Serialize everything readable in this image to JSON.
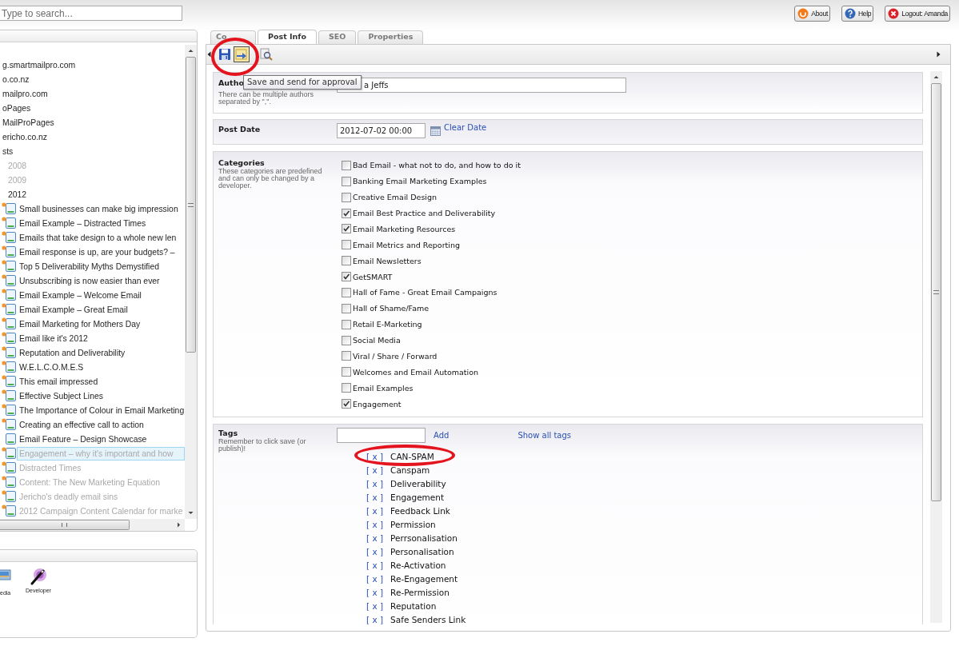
{
  "search": {
    "placeholder": "Type to search..."
  },
  "header_buttons": [
    {
      "kind": "about",
      "label": "About"
    },
    {
      "kind": "help",
      "label": "Help"
    },
    {
      "kind": "logout",
      "label": "Logout: Amanda"
    }
  ],
  "tree": {
    "items": [
      {
        "label": "g.smartmailpro.com",
        "published": true,
        "selected": false
      },
      {
        "label": "o.co.nz",
        "published": true,
        "selected": false
      },
      {
        "label": "mailpro.com",
        "published": true,
        "selected": false
      },
      {
        "label": "oPages",
        "published": true,
        "selected": false
      },
      {
        "label": "MailProPages",
        "published": true,
        "selected": false
      },
      {
        "label": "ericho.co.nz",
        "published": true,
        "selected": false
      },
      {
        "label": "sts",
        "published": true,
        "selected": false,
        "children": [
          {
            "label": "2008",
            "published": false,
            "selected": false
          },
          {
            "label": "2009",
            "published": false,
            "selected": false
          },
          {
            "label": "2012",
            "published": true,
            "selected": false,
            "children": [
              {
                "label": "Small businesses can make big impression",
                "published": true,
                "selected": false,
                "badge": true
              },
              {
                "label": "Email Example – Distracted Times",
                "published": true,
                "selected": false,
                "badge": true
              },
              {
                "label": "Emails that take design to a whole new len",
                "published": true,
                "selected": false,
                "badge": true
              },
              {
                "label": "Email response is up, are your budgets? –",
                "published": true,
                "selected": false,
                "badge": true
              },
              {
                "label": "Top 5 Deliverability Myths Demystified",
                "published": true,
                "selected": false,
                "badge": true
              },
              {
                "label": "Unsubscribing is now easier than ever",
                "published": true,
                "selected": false,
                "badge": true
              },
              {
                "label": "Email Example – Welcome Email",
                "published": true,
                "selected": false,
                "badge": true
              },
              {
                "label": "Email Example – Great Email",
                "published": true,
                "selected": false,
                "badge": true
              },
              {
                "label": "Email Marketing for Mothers Day",
                "published": true,
                "selected": false,
                "badge": true
              },
              {
                "label": "Email like it's 2012",
                "published": true,
                "selected": false,
                "badge": true
              },
              {
                "label": "Reputation and Deliverability",
                "published": true,
                "selected": false,
                "badge": true
              },
              {
                "label": "W.E.L.C.O.M.E.S",
                "published": true,
                "selected": false,
                "badge": true
              },
              {
                "label": "This email impressed",
                "published": true,
                "selected": false,
                "badge": true
              },
              {
                "label": "Effective Subject Lines",
                "published": true,
                "selected": false,
                "badge": true
              },
              {
                "label": "The Importance of Colour in Email Marketing",
                "published": true,
                "selected": false,
                "badge": true
              },
              {
                "label": "Creating an effective call to action",
                "published": true,
                "selected": false,
                "badge": true
              },
              {
                "label": "Email Feature – Design Showcase",
                "published": true,
                "selected": false,
                "badge": false
              },
              {
                "label": "Engagement – why it's important and how",
                "published": false,
                "selected": true,
                "badge": true
              },
              {
                "label": "Distracted Times",
                "published": false,
                "selected": false,
                "badge": true
              },
              {
                "label": "Content: The New Marketing Equation",
                "published": false,
                "selected": false,
                "badge": true
              },
              {
                "label": "Jericho's deadly email sins",
                "published": false,
                "selected": false,
                "badge": true
              },
              {
                "label": "2012 Campaign Content Calendar for marke",
                "published": false,
                "selected": false,
                "badge": true
              }
            ]
          }
        ]
      }
    ]
  },
  "sections_panel": {
    "items": [
      {
        "kind": "media",
        "label": "edia"
      },
      {
        "kind": "developer",
        "label": "Developer"
      }
    ]
  },
  "tabs": [
    {
      "label": "Co",
      "selected": false
    },
    {
      "label": "Post Info",
      "selected": true
    },
    {
      "label": "SEO",
      "selected": false
    },
    {
      "label": "Properties",
      "selected": false
    }
  ],
  "toolbar": [
    {
      "kind": "save",
      "hovered": false
    },
    {
      "kind": "send",
      "hovered": true
    },
    {
      "kind": "preview",
      "hovered": false
    }
  ],
  "tooltip": {
    "text": "Save and send for approval"
  },
  "author": {
    "label": "Autho",
    "hint": "There can be multiple authors separated by \",\".",
    "value": "a Jeffs"
  },
  "post_date": {
    "label": "Post Date",
    "value": "2012-07-02 00:00",
    "clear_link": "Clear Date"
  },
  "categories": {
    "label": "Categories",
    "hint": "These categories are predefined and can only be changed by a developer.",
    "items": [
      {
        "label": "Bad Email - what not to do, and how to do it",
        "checked": false
      },
      {
        "label": "Banking Email Marketing Examples",
        "checked": false
      },
      {
        "label": "Creative Email Design",
        "checked": false
      },
      {
        "label": "Email Best Practice and Deliverability",
        "checked": true
      },
      {
        "label": "Email Marketing Resources",
        "checked": true
      },
      {
        "label": "Email Metrics and Reporting",
        "checked": false
      },
      {
        "label": "Email Newsletters",
        "checked": false
      },
      {
        "label": "GetSMART",
        "checked": true
      },
      {
        "label": "Hall of Fame - Great Email Campaigns",
        "checked": false
      },
      {
        "label": "Hall of Shame/Fame",
        "checked": false
      },
      {
        "label": "Retail E-Marketing",
        "checked": false
      },
      {
        "label": "Social Media",
        "checked": false
      },
      {
        "label": "Viral / Share / Forward",
        "checked": false
      },
      {
        "label": "Welcomes and Email Automation",
        "checked": false
      },
      {
        "label": "Email Examples",
        "checked": false
      },
      {
        "label": "Engagement",
        "checked": true
      }
    ]
  },
  "tags": {
    "label": "Tags",
    "hint": "Remember to click save (or publish)!",
    "add_link": "Add",
    "show_all_link": "Show all tags",
    "items": [
      {
        "remove": "[ x ]",
        "label": "CAN-SPAM"
      },
      {
        "remove": "[ x ]",
        "label": "Canspam"
      },
      {
        "remove": "[ x ]",
        "label": "Deliverability"
      },
      {
        "remove": "[ x ]",
        "label": "Engagement"
      },
      {
        "remove": "[ x ]",
        "label": "Feedback Link"
      },
      {
        "remove": "[ x ]",
        "label": "Permission"
      },
      {
        "remove": "[ x ]",
        "label": "Perrsonalisation"
      },
      {
        "remove": "[ x ]",
        "label": "Personalisation"
      },
      {
        "remove": "[ x ]",
        "label": "Re-Activation"
      },
      {
        "remove": "[ x ]",
        "label": "Re-Engagement"
      },
      {
        "remove": "[ x ]",
        "label": "Re-Permission"
      },
      {
        "remove": "[ x ]",
        "label": "Reputation"
      },
      {
        "remove": "[ x ]",
        "label": "Safe Senders Link"
      }
    ]
  }
}
